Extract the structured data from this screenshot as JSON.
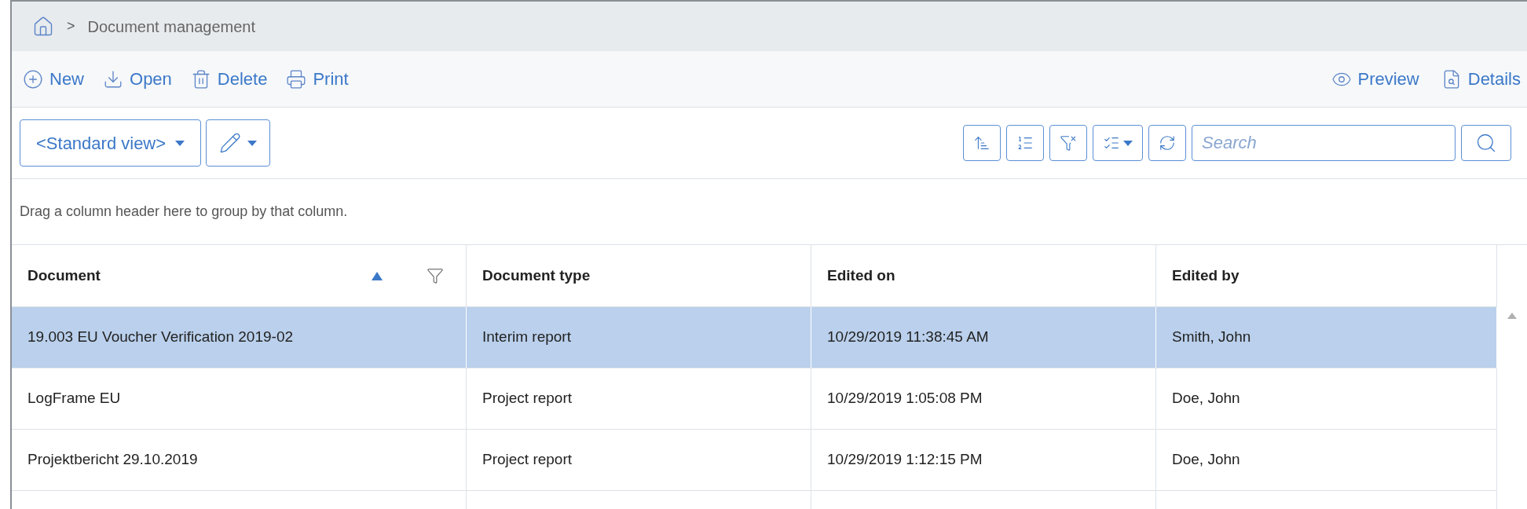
{
  "breadcrumb": {
    "separator": ">",
    "items": [
      "Document management"
    ]
  },
  "toolbar": {
    "left": [
      {
        "kind": "new",
        "label": "New"
      },
      {
        "kind": "open",
        "label": "Open"
      },
      {
        "kind": "delete",
        "label": "Delete"
      },
      {
        "kind": "print",
        "label": "Print"
      }
    ],
    "right": [
      {
        "kind": "preview",
        "label": "Preview"
      },
      {
        "kind": "details",
        "label": "Details"
      }
    ]
  },
  "view_selector": {
    "value": "<Standard view>"
  },
  "search": {
    "placeholder": "Search"
  },
  "group_panel": {
    "hint": "Drag a column header here to group by that column."
  },
  "table": {
    "columns": [
      {
        "label": "Document",
        "sorted": true,
        "filter": true
      },
      {
        "label": "Document type",
        "sorted": false,
        "filter": false
      },
      {
        "label": "Edited on",
        "sorted": false,
        "filter": false
      },
      {
        "label": "Edited by",
        "sorted": false,
        "filter": false
      }
    ],
    "rows": [
      {
        "selected": true,
        "cells": [
          "19.003 EU Voucher Verification 2019-02",
          "Interim report",
          "10/29/2019 11:38:45 AM",
          "Smith, John"
        ]
      },
      {
        "selected": false,
        "cells": [
          "LogFrame EU",
          "Project report",
          "10/29/2019 1:05:08 PM",
          "Doe, John"
        ]
      },
      {
        "selected": false,
        "cells": [
          "Projektbericht 29.10.2019",
          "Project report",
          "10/29/2019 1:12:15 PM",
          "Doe, John"
        ]
      }
    ]
  }
}
